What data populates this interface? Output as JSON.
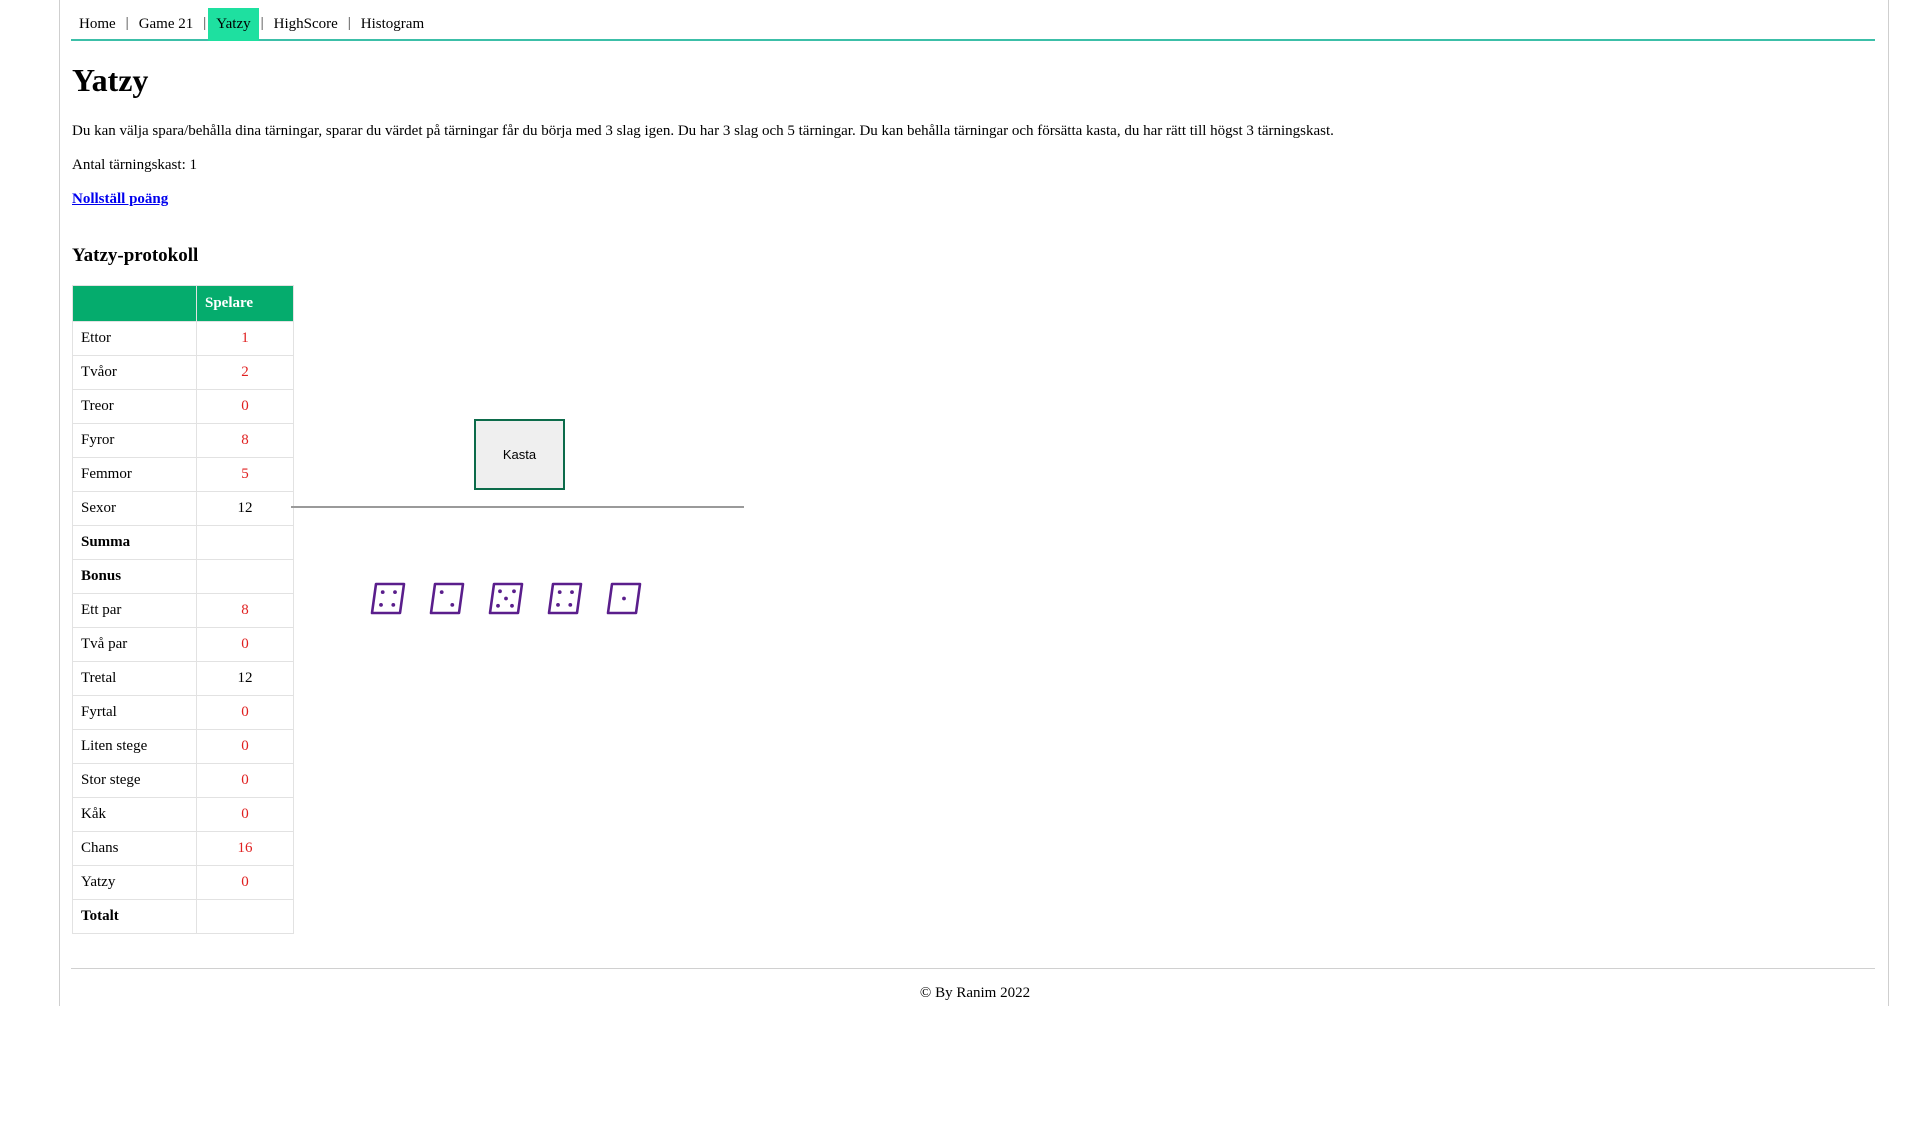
{
  "nav": {
    "items": [
      "Home",
      "Game 21",
      "Yatzy",
      "HighScore",
      "Histogram"
    ],
    "active": "Yatzy",
    "separator": "|"
  },
  "page": {
    "title": "Yatzy",
    "description": "Du kan välja spara/behålla dina tärningar, sparar du värdet på tärningar får du börja med 3 slag igen. Du har 3 slag och 5 tärningar. Du kan behålla tärningar och försätta kasta, du har rätt till högst 3 tärningskast.",
    "throw_count_label": "Antal tärningskast: 1",
    "reset_link": "Nollställ poäng",
    "protocol_heading": "Yatzy-protokoll"
  },
  "table": {
    "header_blank": "",
    "header_player": "Spelare",
    "rows": [
      {
        "label": "Ettor",
        "value": "1",
        "red": true,
        "bold": false
      },
      {
        "label": "Tvåor",
        "value": "2",
        "red": true,
        "bold": false
      },
      {
        "label": "Treor",
        "value": "0",
        "red": true,
        "bold": false
      },
      {
        "label": "Fyror",
        "value": "8",
        "red": true,
        "bold": false
      },
      {
        "label": "Femmor",
        "value": "5",
        "red": true,
        "bold": false
      },
      {
        "label": "Sexor",
        "value": "12",
        "red": false,
        "bold": false
      },
      {
        "label": "Summa",
        "value": "",
        "red": false,
        "bold": true
      },
      {
        "label": "Bonus",
        "value": "",
        "red": false,
        "bold": true
      },
      {
        "label": "Ett par",
        "value": "8",
        "red": true,
        "bold": false
      },
      {
        "label": "Två par",
        "value": "0",
        "red": true,
        "bold": false
      },
      {
        "label": "Tretal",
        "value": "12",
        "red": false,
        "bold": false
      },
      {
        "label": "Fyrtal",
        "value": "0",
        "red": true,
        "bold": false
      },
      {
        "label": "Liten stege",
        "value": "0",
        "red": true,
        "bold": false
      },
      {
        "label": "Stor stege",
        "value": "0",
        "red": true,
        "bold": false
      },
      {
        "label": "Kåk",
        "value": "0",
        "red": true,
        "bold": false
      },
      {
        "label": "Chans",
        "value": "16",
        "red": true,
        "bold": false
      },
      {
        "label": "Yatzy",
        "value": "0",
        "red": true,
        "bold": false
      },
      {
        "label": "Totalt",
        "value": "",
        "red": false,
        "bold": true
      }
    ]
  },
  "game": {
    "throw_button": "Kasta",
    "dice": [
      4,
      2,
      5,
      4,
      1
    ],
    "dice_color": "#5a1e8c"
  },
  "footer": {
    "text": "© By Ranim 2022"
  },
  "colors": {
    "nav_active": "#1ee0a0",
    "nav_underline": "#3cbfa8",
    "table_header": "#05ac6d",
    "score_red": "#e02020"
  }
}
